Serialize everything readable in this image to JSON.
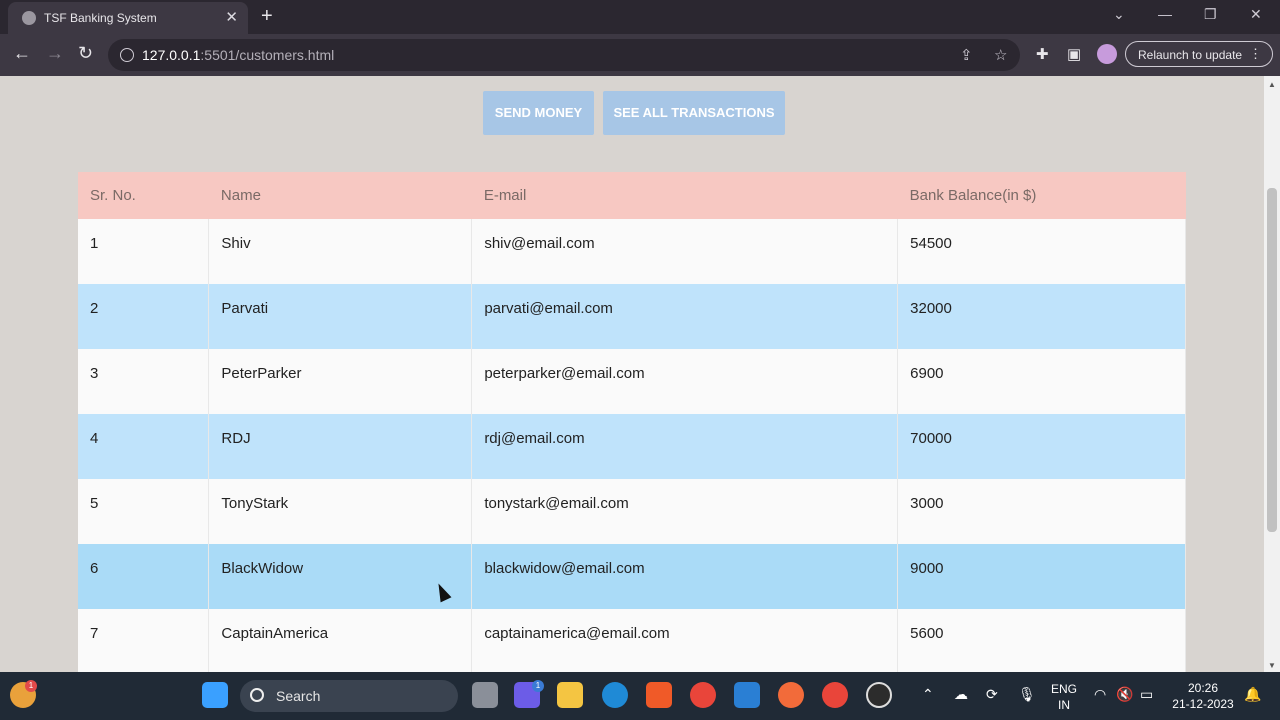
{
  "browser": {
    "tab_title": "TSF Banking System",
    "tab_close": "✕",
    "new_tab": "+",
    "url_host": "127.0.0.1",
    "url_path": ":5501/customers.html",
    "relaunch_label": "Relaunch to update",
    "window_controls": [
      "⌄",
      "—",
      "❐",
      "✕"
    ]
  },
  "page": {
    "buttons": {
      "send_money": "SEND MONEY",
      "see_all_transactions": "SEE ALL TRANSACTIONS"
    },
    "table": {
      "headers": [
        "Sr. No.",
        "Name",
        "E-mail",
        "Bank Balance(in $)"
      ],
      "rows": [
        {
          "sr": "1",
          "name": "Shiv",
          "email": "shiv@email.com",
          "balance": "54500"
        },
        {
          "sr": "2",
          "name": "Parvati",
          "email": "parvati@email.com",
          "balance": "32000"
        },
        {
          "sr": "3",
          "name": "PeterParker",
          "email": "peterparker@email.com",
          "balance": "6900"
        },
        {
          "sr": "4",
          "name": "RDJ",
          "email": "rdj@email.com",
          "balance": "70000"
        },
        {
          "sr": "5",
          "name": "TonyStark",
          "email": "tonystark@email.com",
          "balance": "3000"
        },
        {
          "sr": "6",
          "name": "BlackWidow",
          "email": "blackwidow@email.com",
          "balance": "9000"
        },
        {
          "sr": "7",
          "name": "CaptainAmerica",
          "email": "captainamerica@email.com",
          "balance": "5600"
        }
      ]
    }
  },
  "taskbar": {
    "search_label": "Search",
    "lang_top": "ENG",
    "lang_bottom": "IN",
    "time": "20:26",
    "date": "21-12-2023",
    "widget_badge": "1",
    "teams_badge": "1"
  },
  "colors": {
    "header_row": "#f7c8c2",
    "even_row": "#bfe3fb",
    "button": "#a7c6e6"
  }
}
